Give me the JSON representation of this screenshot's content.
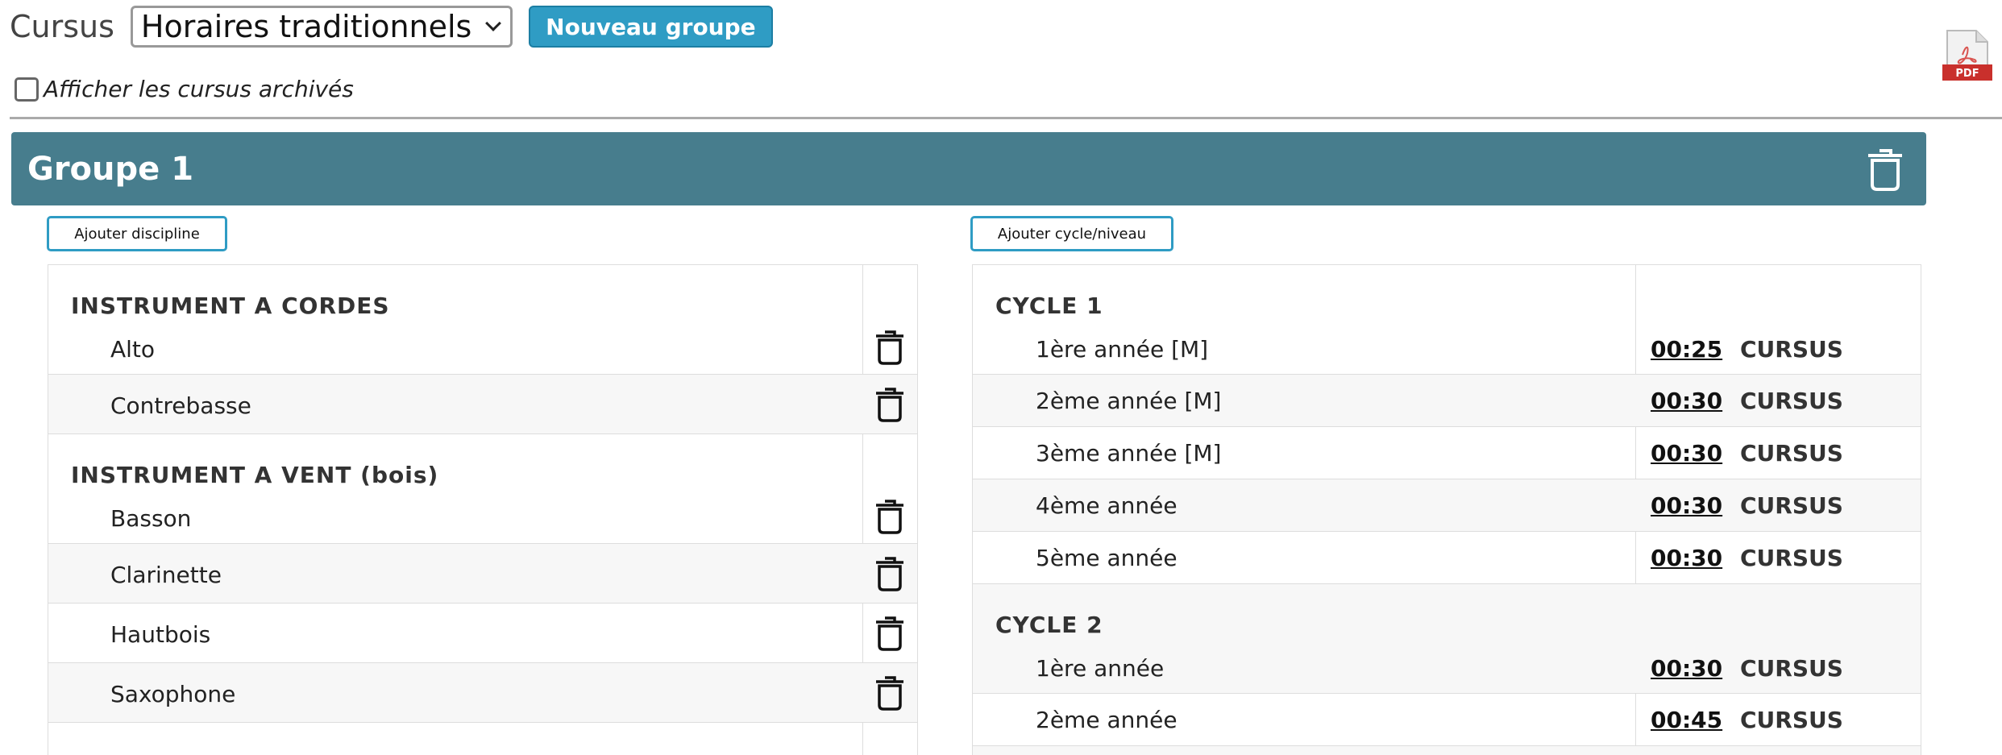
{
  "toolbar": {
    "cursus_label": "Cursus",
    "cursus_selected": "Horaires traditionnels",
    "new_group_label": "Nouveau groupe",
    "show_archived_label": "Afficher les cursus archivés",
    "pdf_label": "PDF"
  },
  "group": {
    "title": "Groupe 1",
    "add_discipline_label": "Ajouter discipline",
    "add_cycle_label": "Ajouter cycle/niveau",
    "disciplines": [
      {
        "category": "INSTRUMENT A CORDES",
        "items": [
          "Alto",
          "Contrebasse"
        ]
      },
      {
        "category": "INSTRUMENT A VENT (bois)",
        "items": [
          "Basson",
          "Clarinette",
          "Hautbois",
          "Saxophone"
        ]
      }
    ],
    "cycles": [
      {
        "name": "CYCLE 1",
        "levels": [
          {
            "label": "1ère année [M]",
            "time": "00:25",
            "tag": "CURSUS"
          },
          {
            "label": "2ème année [M]",
            "time": "00:30",
            "tag": "CURSUS"
          },
          {
            "label": "3ème année [M]",
            "time": "00:30",
            "tag": "CURSUS"
          },
          {
            "label": "4ème année",
            "time": "00:30",
            "tag": "CURSUS"
          },
          {
            "label": "5ème année",
            "time": "00:30",
            "tag": "CURSUS"
          }
        ]
      },
      {
        "name": "CYCLE 2",
        "levels": [
          {
            "label": "1ère année",
            "time": "00:30",
            "tag": "CURSUS"
          },
          {
            "label": "2ème année",
            "time": "00:45",
            "tag": "CURSUS"
          }
        ]
      }
    ]
  },
  "colors": {
    "accent": "#2f9cc4",
    "group_header": "#477d8d"
  }
}
